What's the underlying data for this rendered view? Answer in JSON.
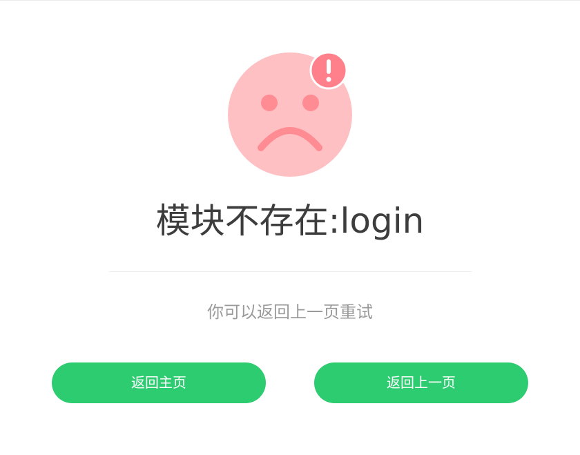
{
  "page": {
    "title": "模块不存在:login",
    "hint": "你可以返回上一页重试"
  },
  "illustration": {
    "face_icon": "sad-face-icon",
    "badge_icon": "exclamation-icon",
    "face_color": "#ffc0c4",
    "feature_color": "#ff8b93",
    "badge_color": "#ff7f8a"
  },
  "actions": {
    "home_label": "返回主页",
    "back_label": "返回上一页",
    "button_color": "#2ecc71"
  }
}
